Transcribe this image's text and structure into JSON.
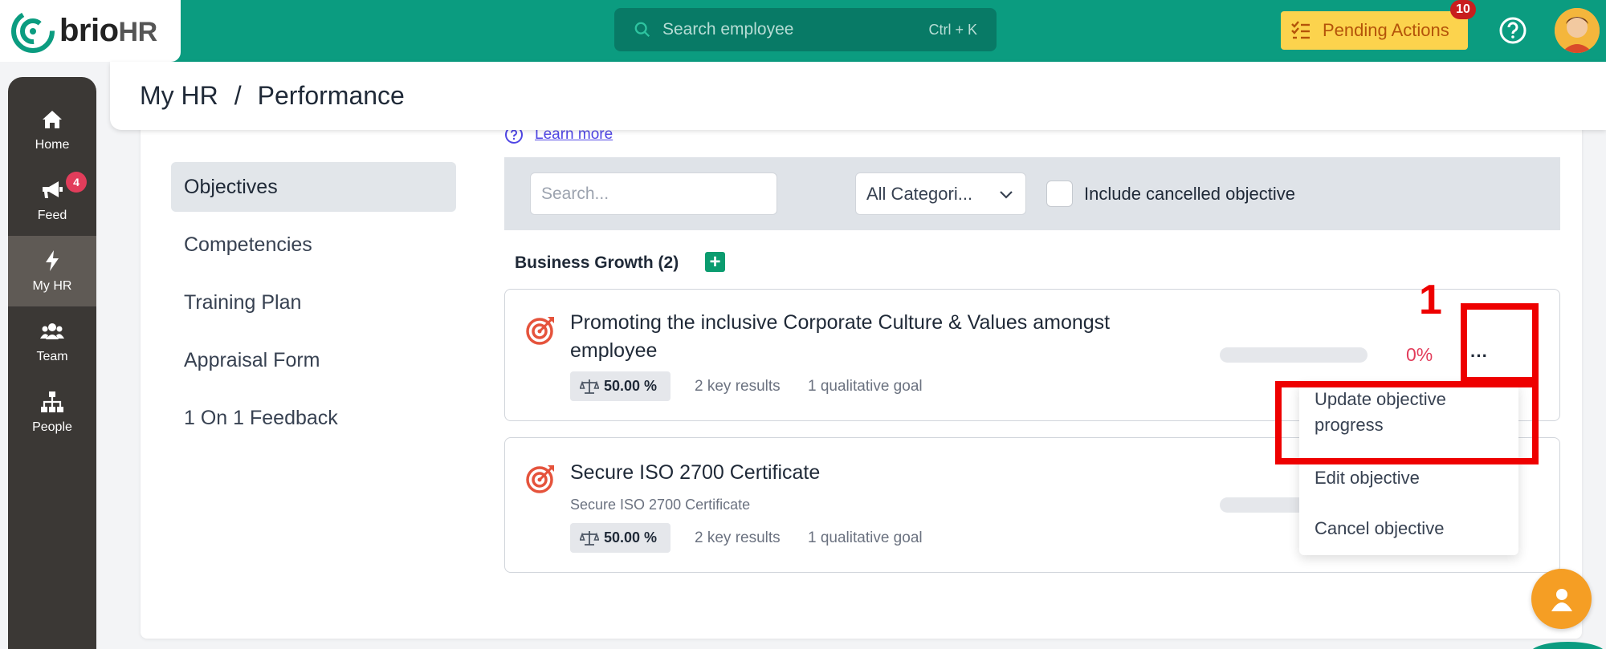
{
  "brand": {
    "name_main": "brio",
    "name_suffix": "HR",
    "accent": "#0b9c80"
  },
  "topbar": {
    "search_placeholder": "Search employee",
    "search_shortcut": "Ctrl + K",
    "pending_label": "Pending Actions",
    "pending_count": "10"
  },
  "sidebar": {
    "items": [
      {
        "label": "Home",
        "icon": "home-icon"
      },
      {
        "label": "Feed",
        "icon": "megaphone-icon",
        "badge": "4"
      },
      {
        "label": "My HR",
        "icon": "bolt-icon"
      },
      {
        "label": "Team",
        "icon": "team-icon"
      },
      {
        "label": "People",
        "icon": "org-chart-icon"
      }
    ]
  },
  "header": {
    "crumb1": "My HR",
    "separator": "/",
    "crumb2": "Performance"
  },
  "learn_more": "Learn more",
  "left_menu": [
    "Objectives",
    "Competencies",
    "Training Plan",
    "Appraisal Form",
    "1 On 1 Feedback"
  ],
  "filters": {
    "search_placeholder": "Search...",
    "category_value": "All Categori...",
    "include_cancelled_label": "Include cancelled objective"
  },
  "group": {
    "title": "Business Growth (2)",
    "add_symbol": "+"
  },
  "objectives": [
    {
      "title": "Promoting the inclusive Corporate Culture & Values amongst employee",
      "subtitle": "",
      "weight": "50.00 %",
      "key_results": "2 key results",
      "qualitative": "1 qualitative goal",
      "progress_text": "0%",
      "progress_fraction": 0,
      "more": "···"
    },
    {
      "title": "Secure ISO 2700 Certificate",
      "subtitle": "Secure ISO 2700 Certificate",
      "weight": "50.00 %",
      "key_results": "2 key results",
      "qualitative": "1 qualitative goal",
      "progress_fraction": 0
    }
  ],
  "dropdown": [
    "Update objective progress",
    "Edit objective",
    "Cancel objective"
  ],
  "annotation": {
    "number": "1",
    "color": "#ee0000"
  }
}
